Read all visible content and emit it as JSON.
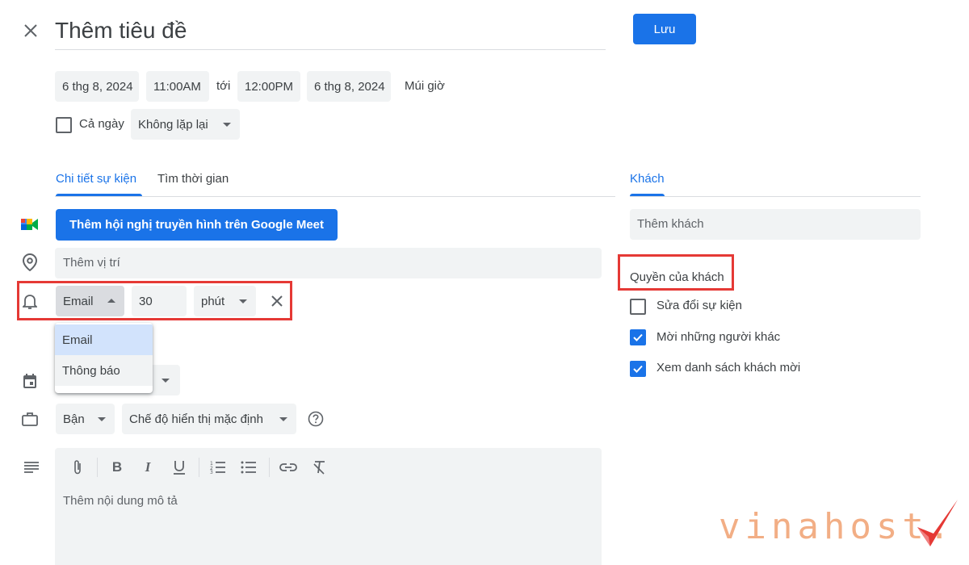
{
  "header": {
    "title_placeholder": "Thêm tiêu đề",
    "save_label": "Lưu"
  },
  "datetime": {
    "start_date": "6 thg 8, 2024",
    "start_time": "11:00AM",
    "to": "tới",
    "end_time": "12:00PM",
    "end_date": "6 thg 8, 2024",
    "timezone": "Múi giờ",
    "all_day": "Cả ngày",
    "repeat": "Không lặp lại"
  },
  "tabs": {
    "details": "Chi tiết sự kiện",
    "find_time": "Tìm thời gian",
    "guests": "Khách"
  },
  "details": {
    "meet_button": "Thêm hội nghị truyền hình trên Google Meet",
    "location_placeholder": "Thêm vị trí",
    "notification": {
      "type": "Email",
      "amount": "30",
      "unit": "phút",
      "options": [
        "Email",
        "Thông báo"
      ]
    },
    "busy": "Bận",
    "visibility": "Chế độ hiển thị mặc định",
    "description_placeholder": "Thêm nội dung mô tả"
  },
  "guests": {
    "add_placeholder": "Thêm khách",
    "permissions_title": "Quyền của khách",
    "permissions": [
      {
        "label": "Sửa đổi sự kiện",
        "checked": false
      },
      {
        "label": "Mời những người khác",
        "checked": true
      },
      {
        "label": "Xem danh sách khách mời",
        "checked": true
      }
    ]
  },
  "watermark": {
    "text": "vinahost.",
    "color": "#f0a070"
  },
  "colors": {
    "accent": "#1a73e8",
    "highlight": "#e53935"
  }
}
